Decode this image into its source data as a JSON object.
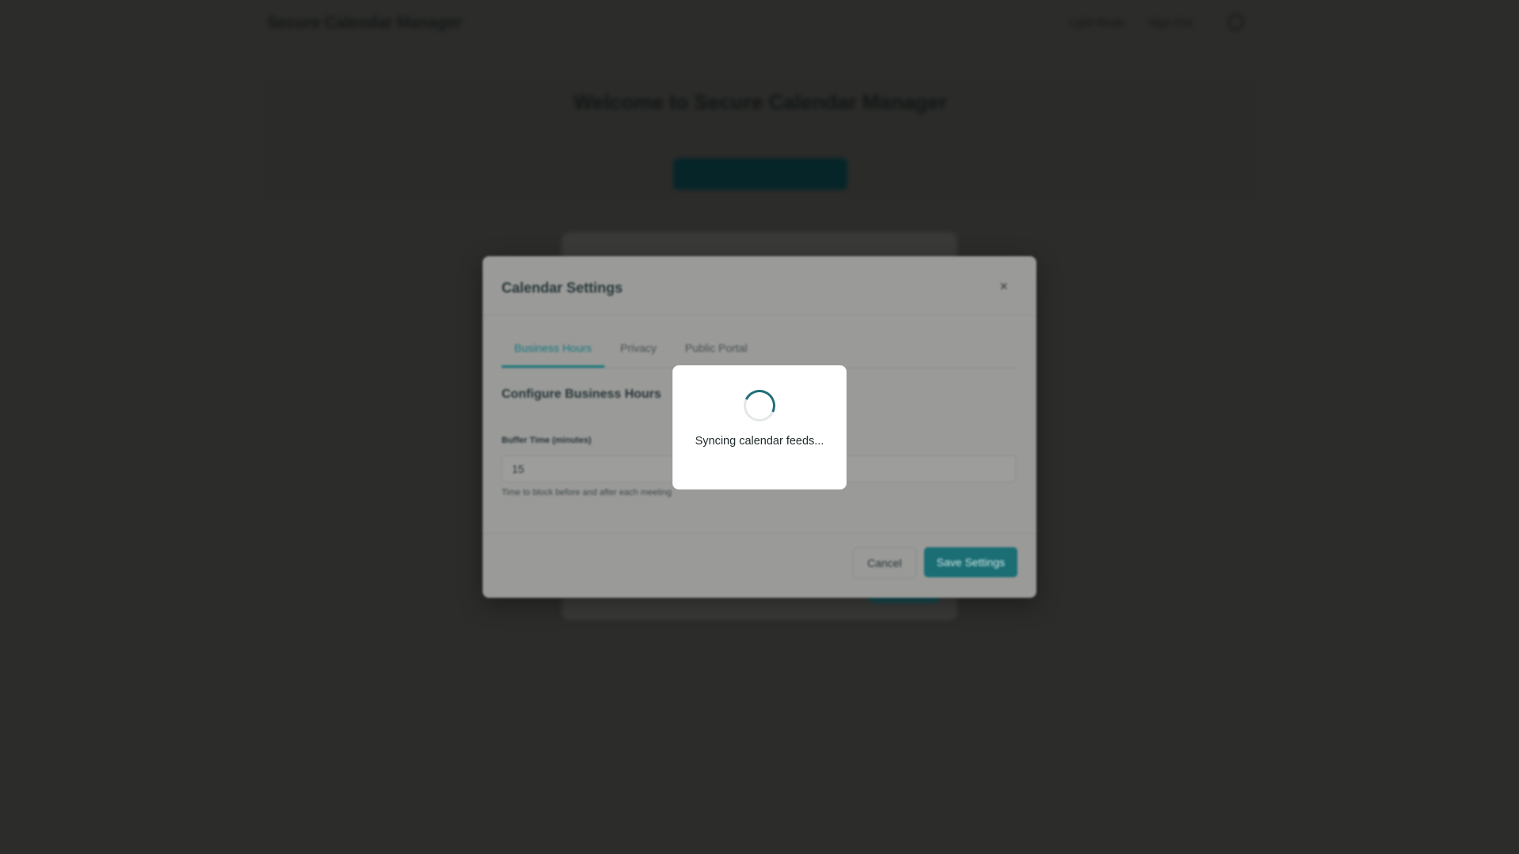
{
  "app": {
    "brand": "Secure Calendar Manager",
    "nav": [
      "Light Mode",
      "Sign Out"
    ]
  },
  "hero": {
    "title": "Welcome to Secure Calendar Manager",
    "subtitle": "",
    "button_label": ""
  },
  "settings_dialog": {
    "title": "Calendar Settings",
    "close_label": "×",
    "tabs": [
      {
        "label": "Business Hours",
        "active": true
      },
      {
        "label": "Privacy",
        "active": false
      },
      {
        "label": "Public Portal",
        "active": false
      }
    ],
    "section_title": "Configure Business Hours",
    "buffer_label": "Buffer Time (minutes)",
    "buffer_value": "15",
    "buffer_help": "Time to block before and after each meeting",
    "cancel_label": "Cancel",
    "save_label": "Save Settings"
  },
  "loading": {
    "text": "Syncing calendar feeds..."
  },
  "colors": {
    "accent": "#1f6f78",
    "overlay": "#2c2c2a",
    "popup_bg": "#ffffff"
  }
}
